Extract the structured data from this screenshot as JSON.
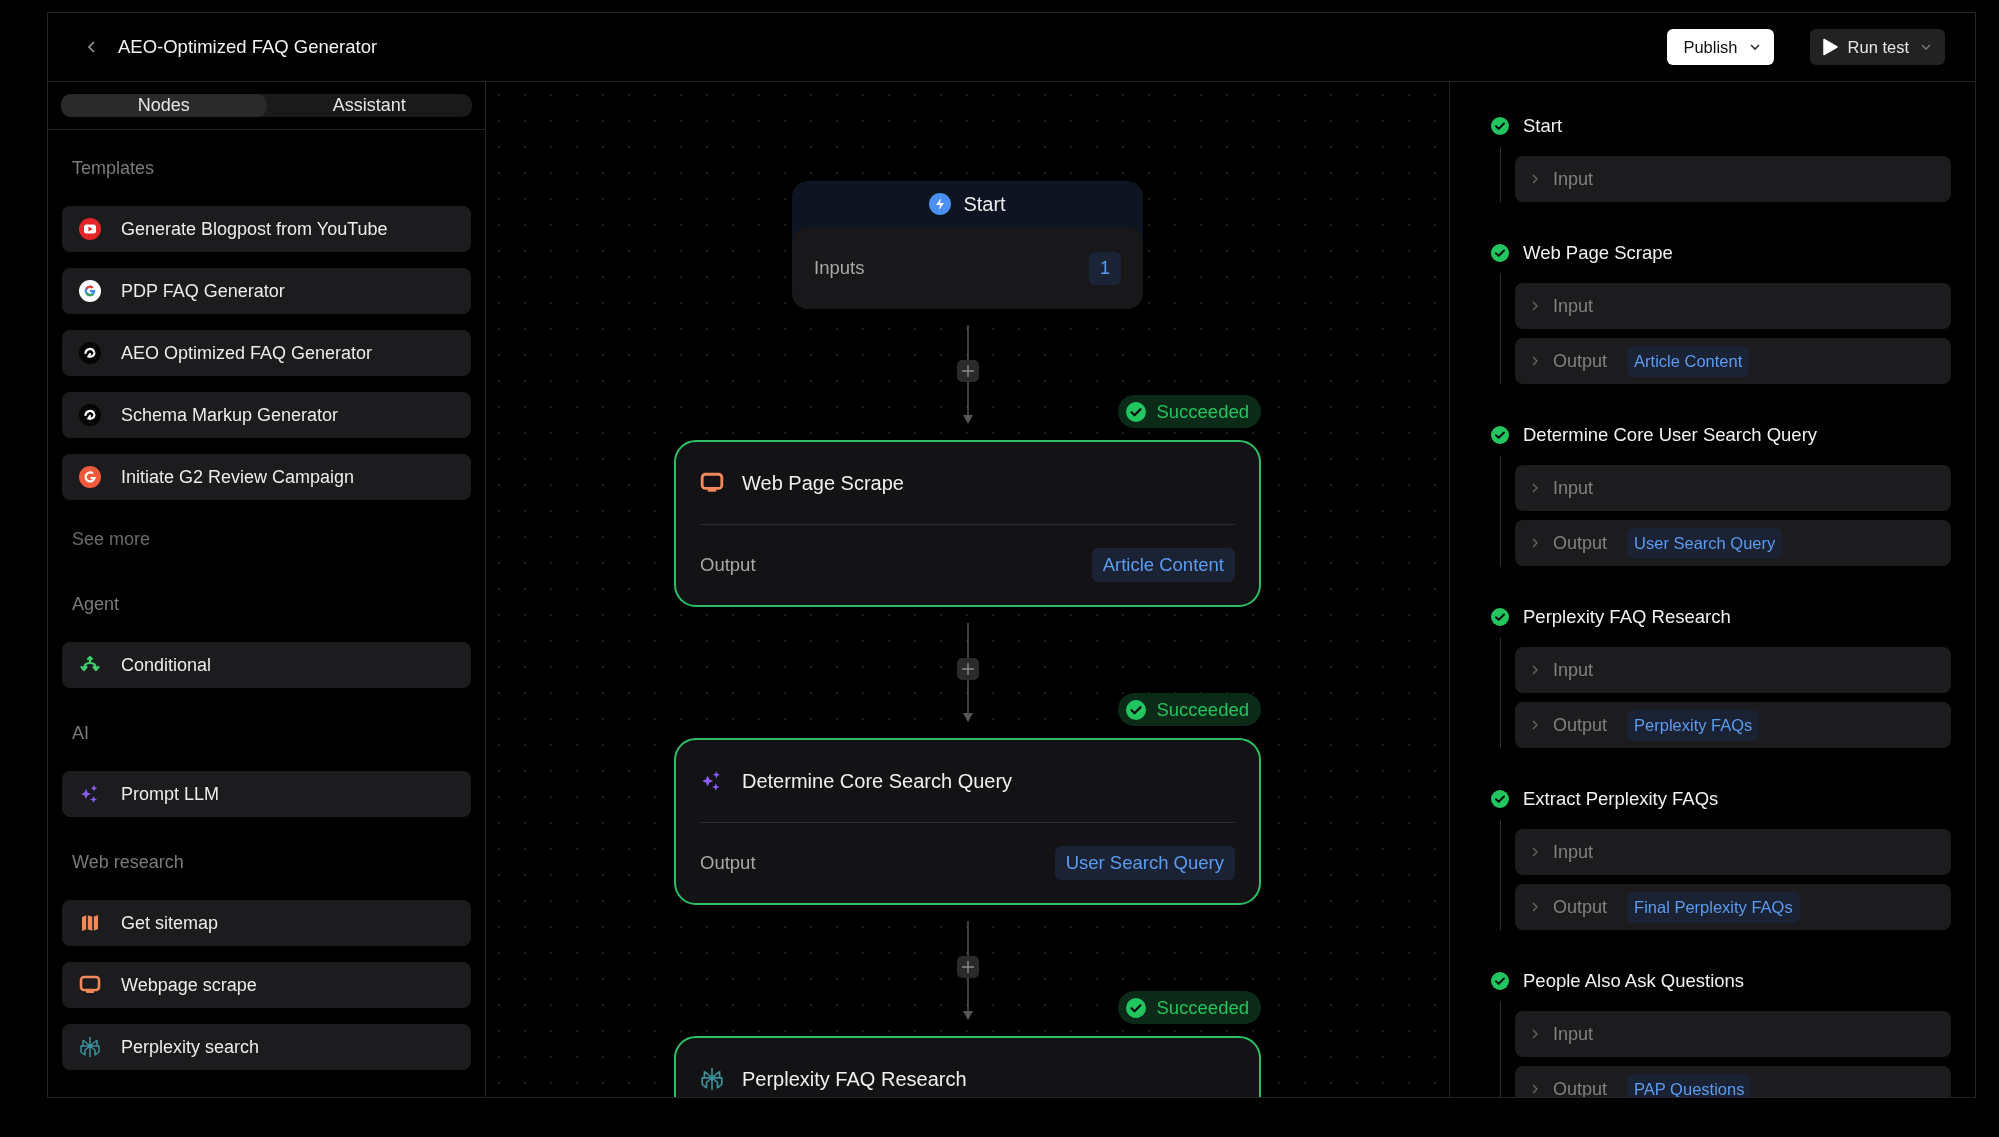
{
  "header": {
    "title": "AEO-Optimized FAQ Generator",
    "publish": "Publish",
    "run_test": "Run test"
  },
  "sidebar": {
    "tabs": [
      {
        "label": "Nodes",
        "selected": true
      },
      {
        "label": "Assistant",
        "selected": false
      }
    ],
    "sections": [
      {
        "title": "Templates",
        "items": [
          {
            "label": "Generate Blogpost from YouTube",
            "kind": "youtube"
          },
          {
            "label": "PDP FAQ Generator",
            "kind": "google"
          },
          {
            "label": "AEO Optimized FAQ Generator",
            "kind": "swirl"
          },
          {
            "label": "Schema Markup Generator",
            "kind": "swirl"
          },
          {
            "label": "Initiate G2 Review Campaign",
            "kind": "g2"
          }
        ],
        "see_more": "See more"
      },
      {
        "title": "Agent",
        "items": [
          {
            "label": "Conditional",
            "kind": "branch"
          }
        ]
      },
      {
        "title": "AI",
        "items": [
          {
            "label": "Prompt LLM",
            "kind": "sparkles"
          }
        ]
      },
      {
        "title": "Web research",
        "items": [
          {
            "label": "Get sitemap",
            "kind": "map"
          },
          {
            "label": "Webpage scrape",
            "kind": "monitor"
          },
          {
            "label": "Perplexity search",
            "kind": "perplexity"
          }
        ]
      }
    ]
  },
  "canvas": {
    "start": {
      "title": "Start",
      "inputs_label": "Inputs",
      "inputs_count": "1"
    },
    "steps": [
      {
        "status": "Succeeded",
        "title": "Web Page Scrape",
        "kind": "monitor",
        "output_label": "Output",
        "output_value": "Article Content"
      },
      {
        "status": "Succeeded",
        "title": "Determine Core Search Query",
        "kind": "sparkles",
        "output_label": "Output",
        "output_value": "User Search Query"
      },
      {
        "status": "Succeeded",
        "title": "Perplexity FAQ Research",
        "kind": "perplexity"
      }
    ]
  },
  "run_log": [
    {
      "title": "Start",
      "succeeded": true,
      "rows": [
        {
          "label": "Input",
          "expanded": false
        }
      ]
    },
    {
      "title": "Web Page Scrape",
      "succeeded": true,
      "rows": [
        {
          "label": "Input",
          "expanded": false
        },
        {
          "label": "Output",
          "value": "Article Content",
          "expanded": false
        }
      ]
    },
    {
      "title": "Determine Core User Search Query",
      "succeeded": true,
      "rows": [
        {
          "label": "Input",
          "expanded": false
        },
        {
          "label": "Output",
          "value": "User Search Query",
          "expanded": false
        }
      ]
    },
    {
      "title": "Perplexity FAQ Research",
      "succeeded": true,
      "rows": [
        {
          "label": "Input",
          "expanded": false
        },
        {
          "label": "Output",
          "value": "Perplexity FAQs",
          "expanded": false
        }
      ]
    },
    {
      "title": "Extract Perplexity FAQs",
      "succeeded": true,
      "rows": [
        {
          "label": "Input",
          "expanded": false
        },
        {
          "label": "Output",
          "value": "Final Perplexity FAQs",
          "expanded": false
        }
      ]
    },
    {
      "title": "People Also Ask Questions",
      "succeeded": true,
      "rows": [
        {
          "label": "Input",
          "expanded": false
        },
        {
          "label": "Output",
          "value": "PAP Questions",
          "expanded": false
        }
      ]
    }
  ]
}
